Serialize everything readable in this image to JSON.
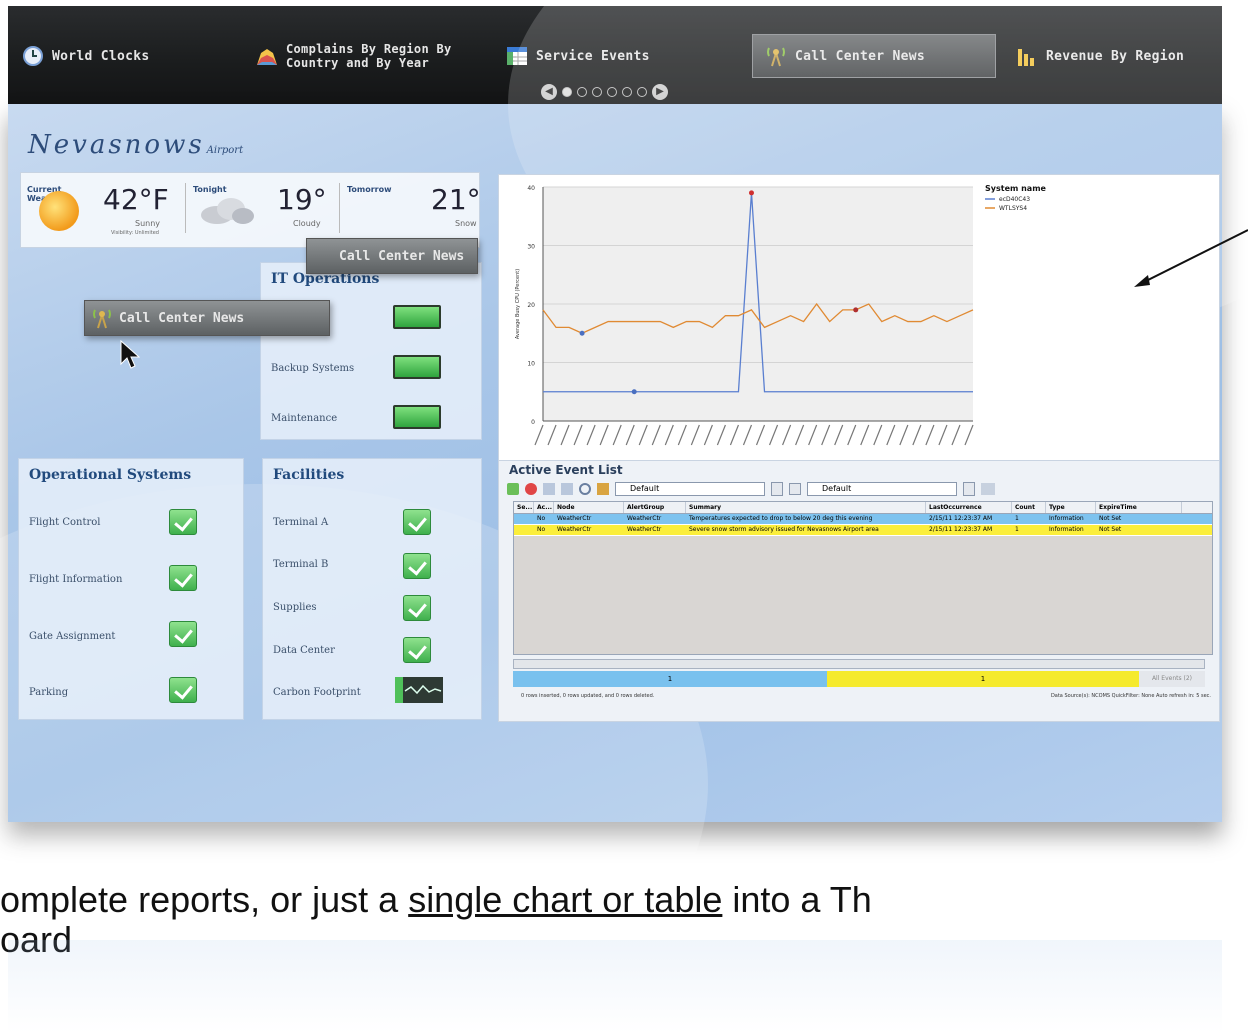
{
  "nav": {
    "items": [
      {
        "label": "World Clocks",
        "icon": "clock-icon"
      },
      {
        "label_line1": "Complains By Region By",
        "label_line2": "Country and By Year",
        "icon": "stack-chart-icon"
      },
      {
        "label": "Service Events",
        "icon": "table-icon"
      },
      {
        "label": "Call Center News",
        "icon": "antenna-icon",
        "active": true
      },
      {
        "label": "Revenue By Region",
        "icon": "bar-chart-icon"
      }
    ],
    "page_count": 6,
    "current_page": 1
  },
  "logo": {
    "name": "Nevasnows",
    "sub": "Airport"
  },
  "weather": {
    "current_label": "Current Weather",
    "current_temp": "42°F",
    "current_cond": "Sunny",
    "current_vis": "Visibility: Unlimited",
    "tonight_label": "Tonight",
    "tonight_temp": "19°",
    "tonight_cond": "Cloudy",
    "tomorrow_label": "Tomorrow",
    "tomorrow_temp": "21°",
    "tomorrow_cond": "Snow"
  },
  "drag_ghosts": [
    "Call Center News",
    "Call Center News"
  ],
  "it_operations": {
    "title": "IT Operations",
    "rows": [
      "Backup Systems",
      "Maintenance"
    ]
  },
  "operational_systems": {
    "title": "Operational Systems",
    "rows": [
      "Flight Control",
      "Flight Information",
      "Gate Assignment",
      "Parking"
    ]
  },
  "facilities": {
    "title": "Facilities",
    "rows": [
      "Terminal A",
      "Terminal B",
      "Supplies",
      "Data Center",
      "Carbon Footprint"
    ]
  },
  "chart_data": {
    "type": "line",
    "ylabel": "Average Busy CPU (Percent)",
    "ylim": [
      0,
      40
    ],
    "yticks": [
      0,
      10,
      20,
      30,
      40
    ],
    "legend_title": "System name",
    "series": [
      {
        "name": "ecD40C43",
        "color": "#5a7fd0",
        "values": [
          5,
          5,
          5,
          5,
          5,
          5,
          5,
          5,
          5,
          5,
          5,
          5,
          5,
          5,
          5,
          5,
          39,
          5,
          5,
          5,
          5,
          5,
          5,
          5,
          5,
          5,
          5,
          5,
          5,
          5,
          5,
          5,
          5,
          5
        ]
      },
      {
        "name": "WTLSYS4",
        "color": "#e08a33",
        "values": [
          19,
          16,
          16,
          15,
          16,
          17,
          17,
          17,
          17,
          17,
          16,
          17,
          17,
          16,
          18,
          18,
          19,
          16,
          17,
          18,
          17,
          20,
          17,
          19,
          19,
          20,
          17,
          18,
          17,
          17,
          18,
          17,
          18,
          19
        ]
      }
    ],
    "legend_position": "top-right"
  },
  "events": {
    "title": "Active Event List",
    "filter1": "Default",
    "filter2": "Default",
    "columns": [
      "Se...",
      "Ac...",
      "Node",
      "AlertGroup",
      "Summary",
      "LastOccurrence",
      "Count",
      "Type",
      "ExpireTime"
    ],
    "rows": [
      {
        "cells": [
          "",
          "No",
          "WeatherCtr",
          "WeatherCtr",
          "Temperatures expected to drop to below 20 deg this evening",
          "2/15/11 12:23:37 AM",
          "1",
          "Information",
          "Not Set"
        ],
        "color": "#7ec3ef"
      },
      {
        "cells": [
          "",
          "No",
          "WeatherCtr",
          "WeatherCtr",
          "Severe snow storm advisory issued for Nevasnows Airport area",
          "2/15/11 12:23:37 AM",
          "1",
          "Information",
          "Not Set"
        ],
        "color": "#fbee3b"
      }
    ],
    "summary_info": "1",
    "summary_warn": "1",
    "all_events": "All Events (2)",
    "status_left": "0 rows inserted, 0 rows updated, and 0 rows deleted.",
    "status_right": "Data Source(s): NCOMS   QuickFilter: None   Auto refresh in: 5 sec."
  },
  "caption": {
    "pre": "omplete reports, or just a ",
    "link": "single chart or table",
    "post": " into a Th",
    "line2": "oard"
  }
}
